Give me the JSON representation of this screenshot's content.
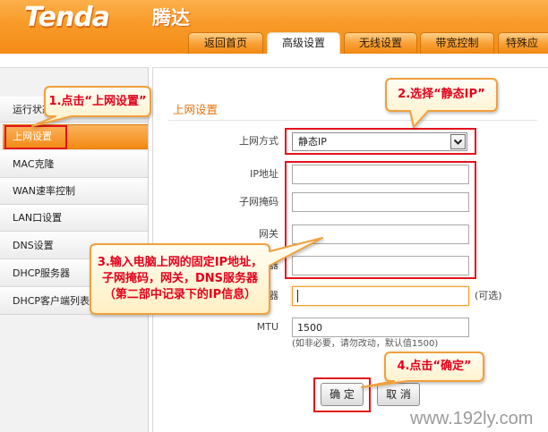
{
  "brand": {
    "logo": "Tenda",
    "logo_cn": "腾达"
  },
  "colors": {
    "header_orange": "#f89a28",
    "accent_orange": "#f28a14",
    "section_title": "#e8720a",
    "annotation_red": "#e2141c",
    "callout_text": "#e3001b",
    "callout_border": "#f0a03c"
  },
  "tabs": [
    {
      "label": "返回首页",
      "active": false
    },
    {
      "label": "高级设置",
      "active": true
    },
    {
      "label": "无线设置",
      "active": false
    },
    {
      "label": "带宽控制",
      "active": false
    },
    {
      "label": "特殊应",
      "active": false
    }
  ],
  "sidebar": {
    "items": [
      {
        "label": "运行状态",
        "active": false
      },
      {
        "label": "上网设置",
        "active": true
      },
      {
        "label": "MAC克隆",
        "active": false
      },
      {
        "label": "WAN速率控制",
        "active": false
      },
      {
        "label": "LAN口设置",
        "active": false
      },
      {
        "label": "DNS设置",
        "active": false
      },
      {
        "label": "DHCP服务器",
        "active": false
      },
      {
        "label": "DHCP客户端列表",
        "active": false
      }
    ]
  },
  "main": {
    "section_title": "上网设置",
    "form": {
      "connection_type": {
        "label": "上网方式",
        "value": "静态IP",
        "icon": "chevron-down-icon"
      },
      "ip_address": {
        "label": "IP地址",
        "value": ""
      },
      "subnet_mask": {
        "label": "子网掩码",
        "value": ""
      },
      "gateway": {
        "label": "网关",
        "value": ""
      },
      "primary_dns": {
        "label": "器",
        "value": ""
      },
      "secondary_dns": {
        "label": "器",
        "value": "",
        "note": "(可选)",
        "focused": true
      },
      "mtu": {
        "label": "MTU",
        "value": "1500",
        "hint": "(如非必要，请勿改动，默认值1500)"
      }
    },
    "buttons": {
      "ok": "确 定",
      "cancel": "取 消"
    }
  },
  "callouts": {
    "step1": "1.点击“上网设置”",
    "step2": "2.选择“静态IP”",
    "step3": [
      "3.输入电脑上网的固定IP地址，",
      "子网掩码，网关，DNS服务器",
      "（第二部中记录下的IP信息）"
    ],
    "step4": "4.点击“确定”"
  },
  "watermark": "www.192ly.com"
}
